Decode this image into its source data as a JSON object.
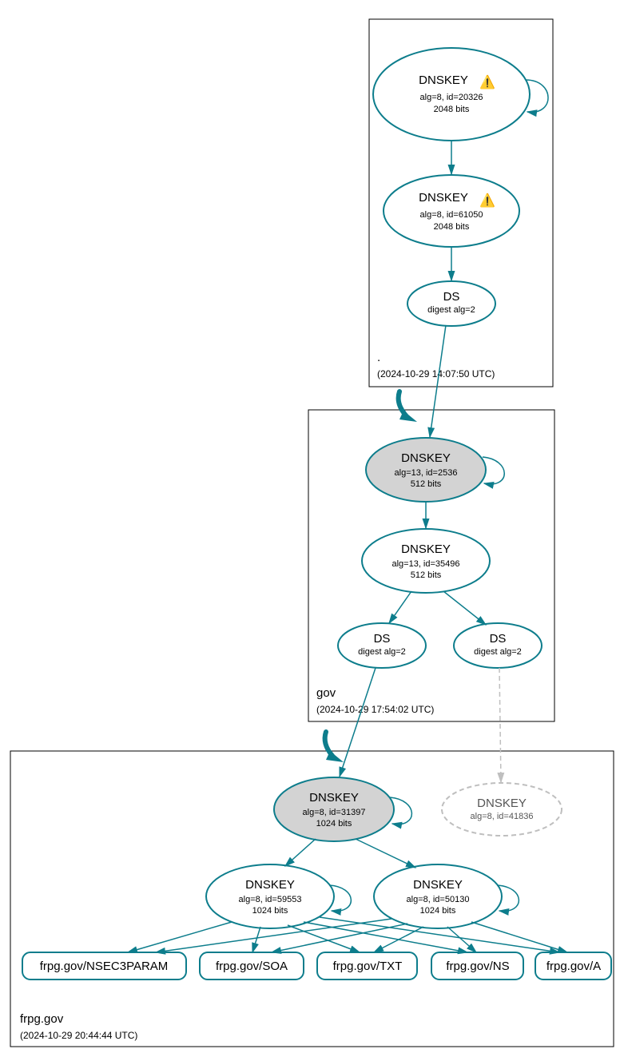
{
  "zones": {
    "root": {
      "label": ".",
      "time": "(2024-10-29 14:07:50 UTC)"
    },
    "gov": {
      "label": "gov",
      "time": "(2024-10-29 17:54:02 UTC)"
    },
    "frpg": {
      "label": "frpg.gov",
      "time": "(2024-10-29 20:44:44 UTC)"
    }
  },
  "nodes": {
    "root_ksk": {
      "title": "DNSKEY",
      "warn": "⚠️",
      "l1": "alg=8, id=20326",
      "l2": "2048 bits"
    },
    "root_zsk": {
      "title": "DNSKEY",
      "warn": "⚠️",
      "l1": "alg=8, id=61050",
      "l2": "2048 bits"
    },
    "root_ds": {
      "title": "DS",
      "l1": "digest alg=2"
    },
    "gov_ksk": {
      "title": "DNSKEY",
      "l1": "alg=13, id=2536",
      "l2": "512 bits"
    },
    "gov_zsk": {
      "title": "DNSKEY",
      "l1": "alg=13, id=35496",
      "l2": "512 bits"
    },
    "gov_ds1": {
      "title": "DS",
      "l1": "digest alg=2"
    },
    "gov_ds2": {
      "title": "DS",
      "l1": "digest alg=2"
    },
    "frpg_ksk": {
      "title": "DNSKEY",
      "l1": "alg=8, id=31397",
      "l2": "1024 bits"
    },
    "frpg_zsk1": {
      "title": "DNSKEY",
      "l1": "alg=8, id=59553",
      "l2": "1024 bits"
    },
    "frpg_zsk2": {
      "title": "DNSKEY",
      "l1": "alg=8, id=50130",
      "l2": "1024 bits"
    },
    "frpg_inactive": {
      "title": "DNSKEY",
      "l1": "alg=8, id=41836"
    },
    "rr": {
      "nsec3": "frpg.gov/NSEC3PARAM",
      "soa": "frpg.gov/SOA",
      "txt": "frpg.gov/TXT",
      "ns": "frpg.gov/NS",
      "a": "frpg.gov/A"
    }
  }
}
